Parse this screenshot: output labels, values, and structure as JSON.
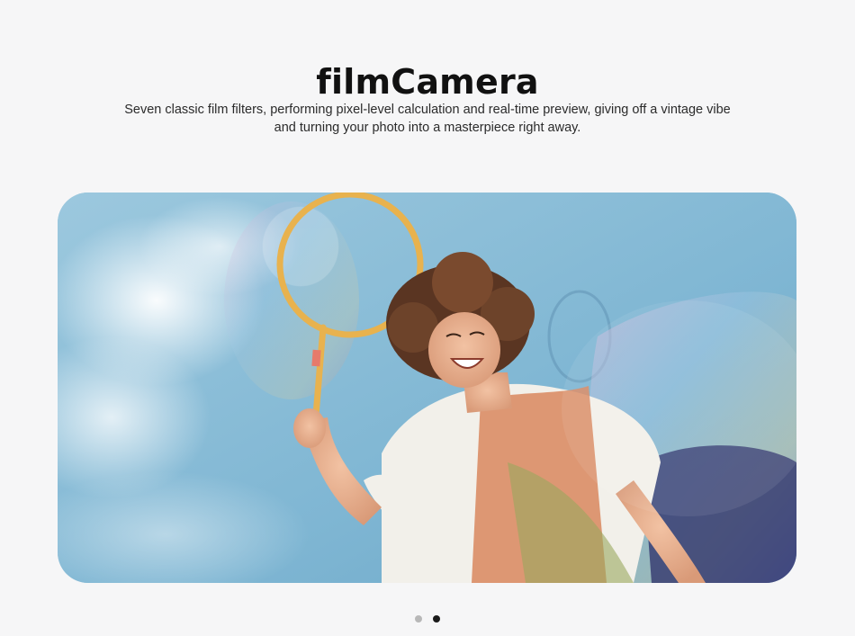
{
  "header": {
    "title": "filmCamera",
    "description_line1": "Seven classic film filters, performing pixel-level calculation and real-time preview, giving off a vintage vibe",
    "description_line2": "and turning your photo into a masterpiece right away."
  },
  "hero": {
    "image_icon": "photo-person-with-bubble-wand"
  },
  "carousel": {
    "slide_count": 2,
    "active_index": 1
  }
}
